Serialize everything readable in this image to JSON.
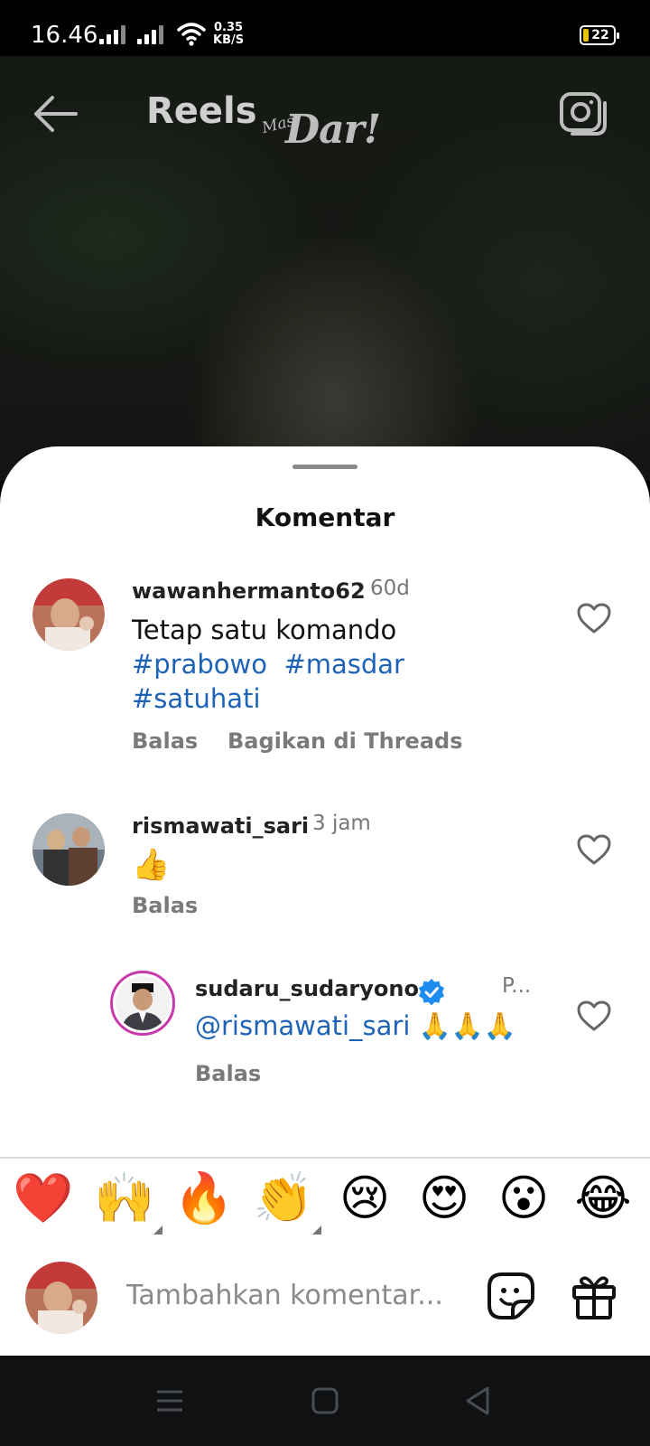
{
  "status_bar": {
    "time": "16.46",
    "net_speed_value": "0.35",
    "net_speed_unit": "KB/S",
    "battery": "22"
  },
  "header": {
    "title": "Reels",
    "logo_small": "Mas",
    "logo_large": "Dar!"
  },
  "sheet": {
    "title": "Komentar"
  },
  "comments": [
    {
      "username": "wawanhermanto62",
      "time": "60d",
      "text": "Tetap satu komando",
      "hashtags": [
        "#prabowo",
        "#masdar",
        "#satuhati"
      ],
      "reply_label": "Balas",
      "share_label": "Bagikan di Threads"
    },
    {
      "username": "rismawati_sari",
      "time": "3 jam",
      "text": "👍",
      "reply_label": "Balas"
    }
  ],
  "reply": {
    "username": "sudaru_sudaryono",
    "time": "P...",
    "mention": "@rismawati_sari",
    "text": "🙏🙏🙏",
    "reply_label": "Balas"
  },
  "emoji_bar": [
    "❤️",
    "🙌",
    "🔥",
    "👏",
    "😢",
    "😍",
    "😮",
    "😂"
  ],
  "input": {
    "placeholder": "Tambahkan komentar..."
  },
  "colors": {
    "hashtag": "#1e63b8",
    "verified": "#1d8cf0",
    "sheet_bg": "#ffffff"
  },
  "icons": [
    "back-arrow-icon",
    "camera-icon",
    "heart-icon",
    "verified-badge-icon",
    "sticker-icon",
    "gift-icon",
    "menu-icon",
    "home-square-icon",
    "back-triangle-icon"
  ]
}
